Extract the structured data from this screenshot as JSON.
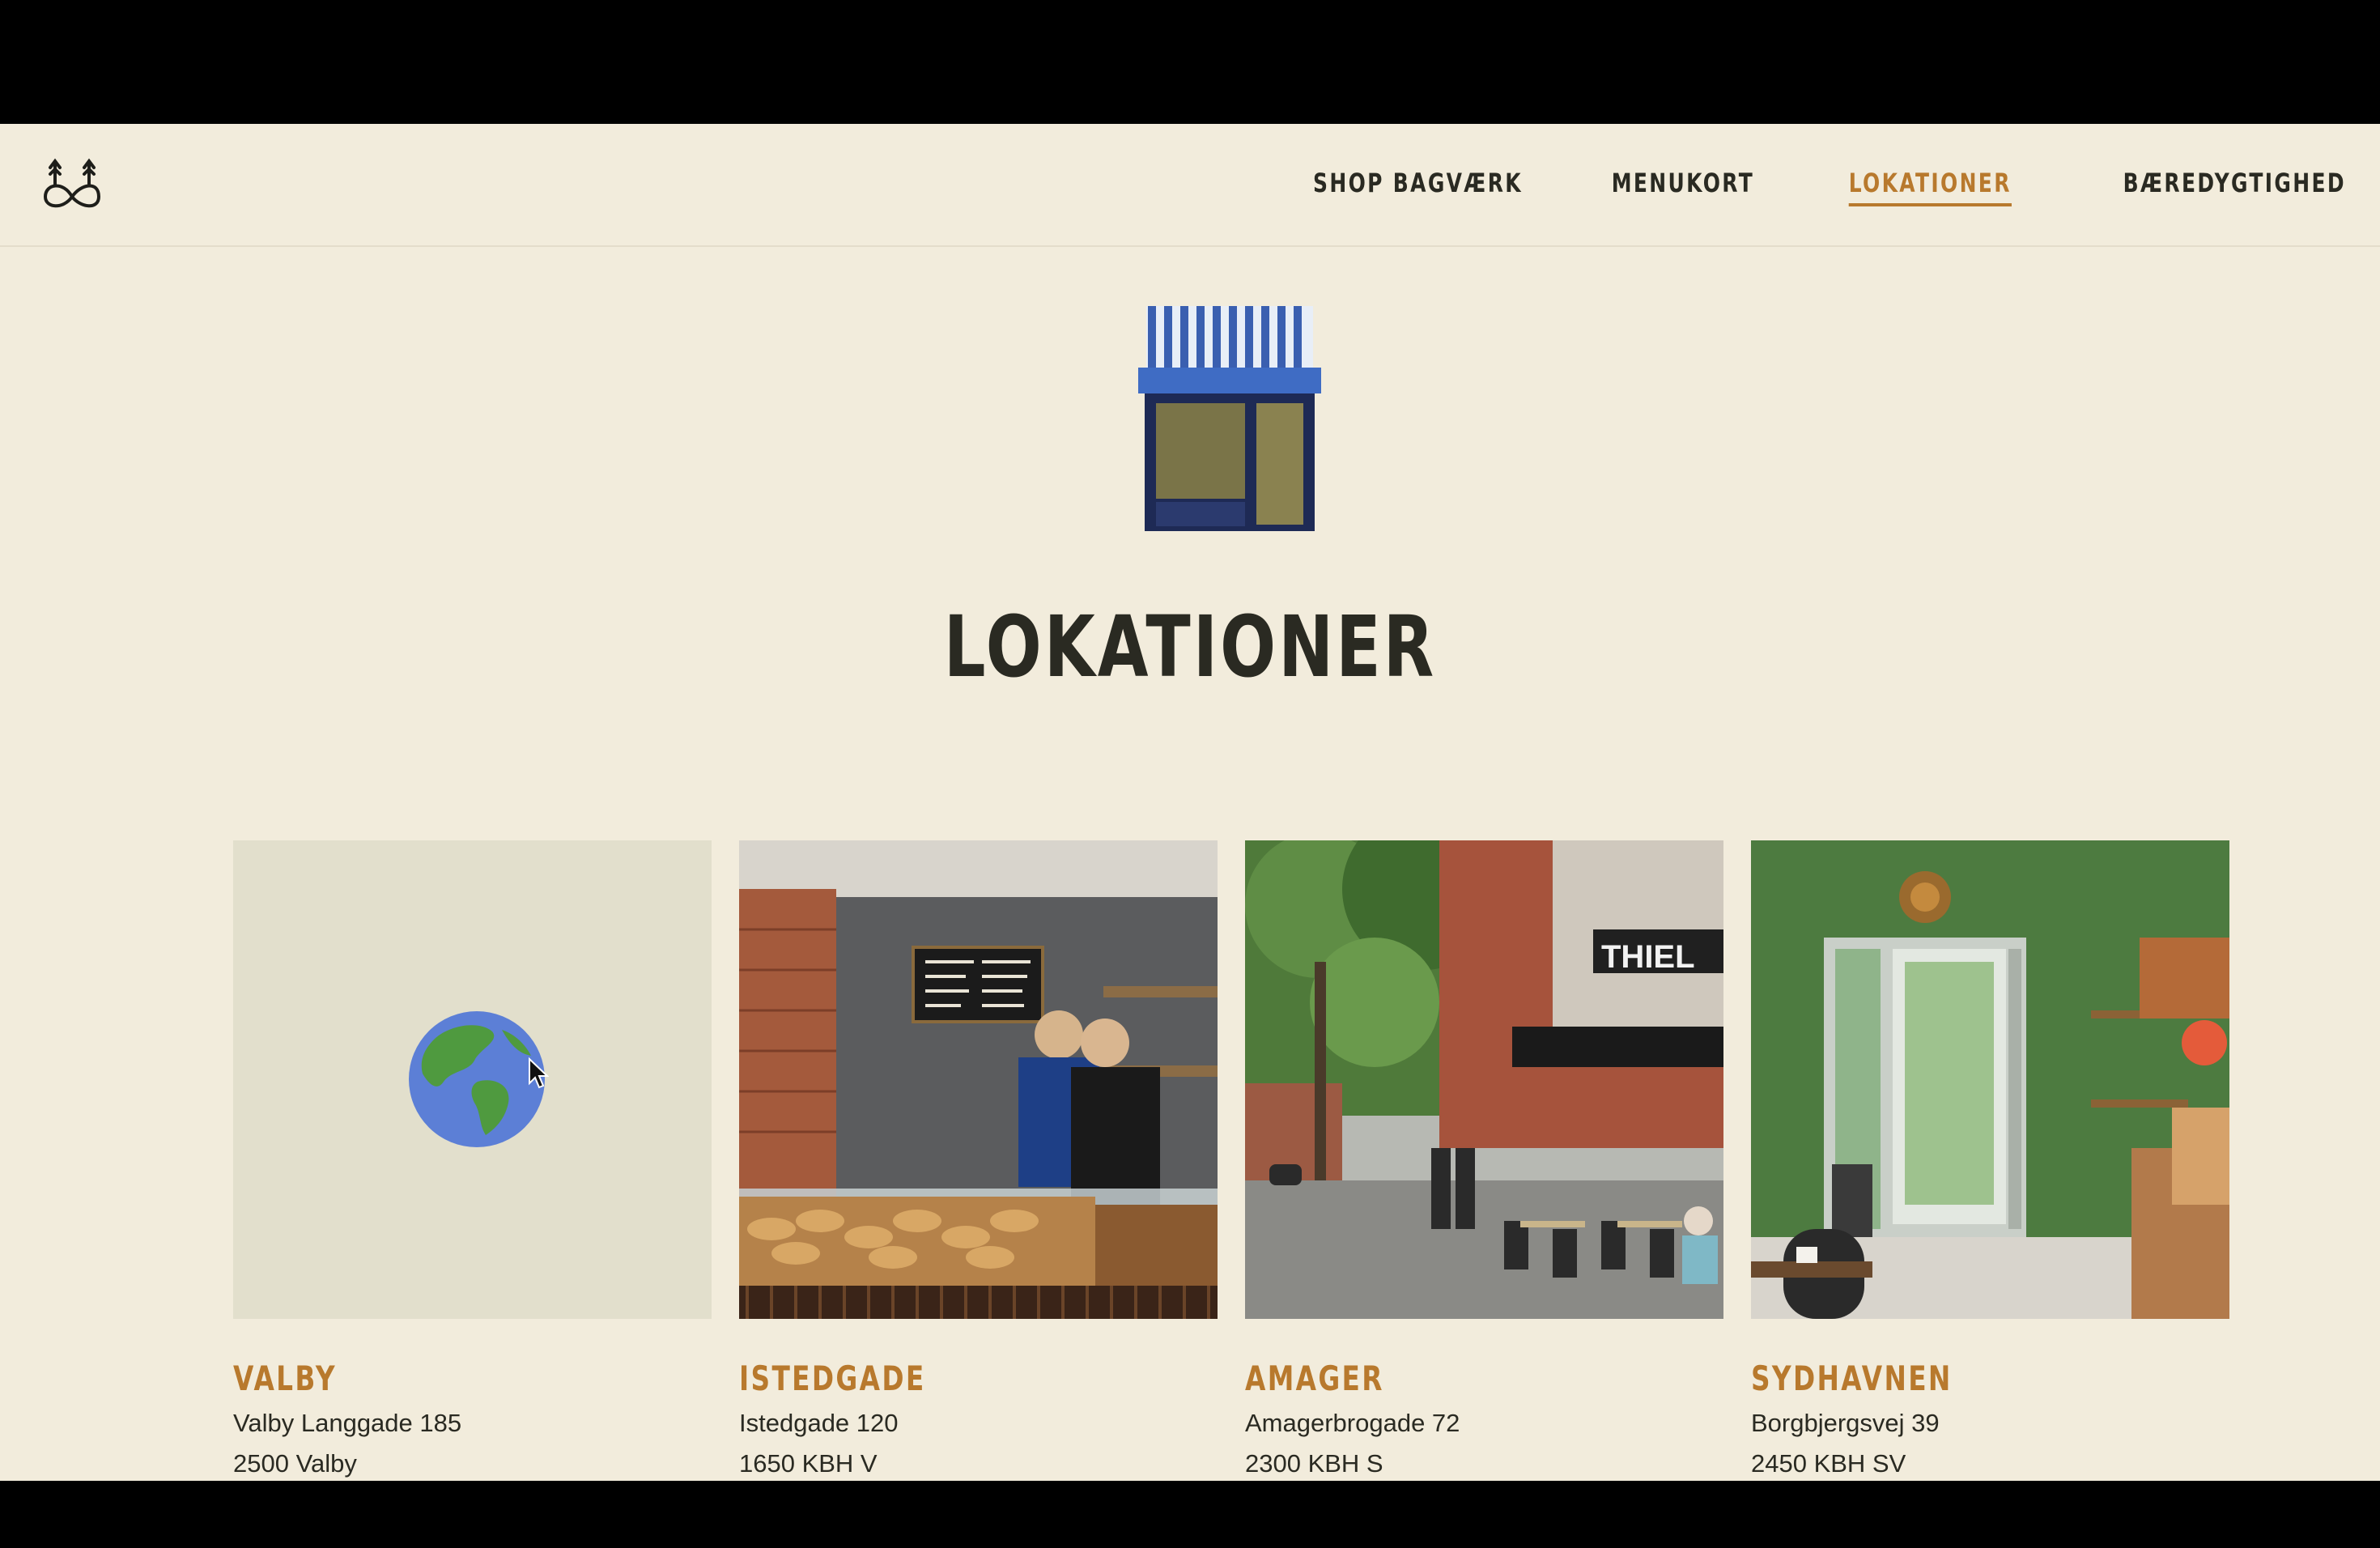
{
  "nav": {
    "items": [
      {
        "label": "SHOP BAGVÆRK"
      },
      {
        "label": "MENUKORT"
      },
      {
        "label": "LOKATIONER",
        "active": true
      },
      {
        "label": "BÆREDYGTIGHED"
      }
    ]
  },
  "page": {
    "title": "LOKATIONER"
  },
  "locations": [
    {
      "name": "VALBY",
      "street": "Valby Langgade 185",
      "city": "2500 Valby",
      "image": "globe-icon"
    },
    {
      "name": "ISTEDGADE",
      "street": "Istedgade 120",
      "city": "1650 KBH V",
      "image": "bakery-counter-photo"
    },
    {
      "name": "AMAGER",
      "street": "Amagerbrogade 72",
      "city": "2300 KBH S",
      "image": "street-cafe-photo"
    },
    {
      "name": "SYDHAVNEN",
      "street": "Borgbjergsvej 39",
      "city": "2450 KBH SV",
      "image": "green-interior-photo"
    }
  ],
  "colors": {
    "background": "#f2ecdc",
    "accent": "#b8792d",
    "text": "#2a2a22",
    "letterbox": "#000000"
  }
}
